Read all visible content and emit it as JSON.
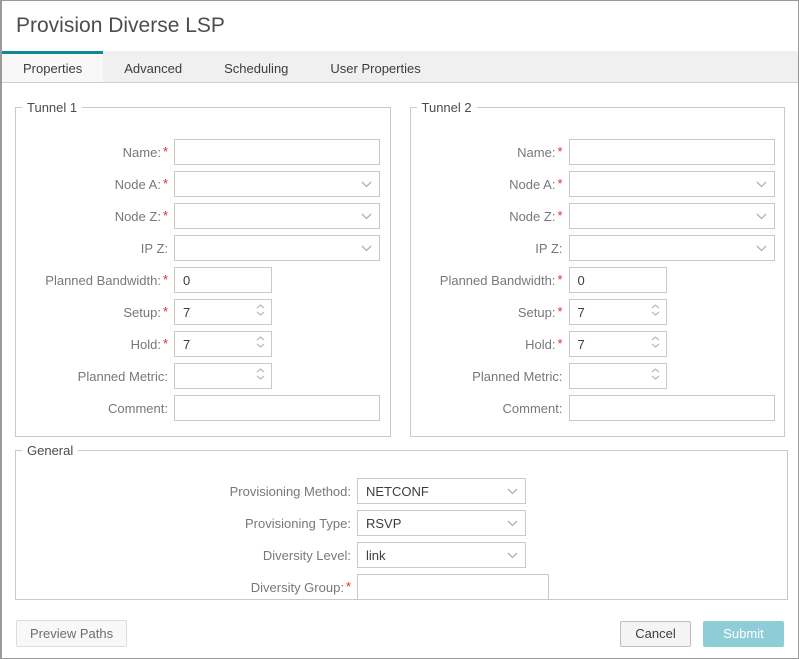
{
  "header": {
    "title": "Provision Diverse LSP"
  },
  "tabs": [
    {
      "label": "Properties",
      "active": true
    },
    {
      "label": "Advanced",
      "active": false
    },
    {
      "label": "Scheduling",
      "active": false
    },
    {
      "label": "User Properties",
      "active": false
    }
  ],
  "ui": {
    "required_marker": "*"
  },
  "colors": {
    "accent_teal": "#0e8a96",
    "submit_bg": "#8ecdd8",
    "required_red": "#e32b24"
  },
  "tunnel1": {
    "legend": "Tunnel 1",
    "fields": [
      {
        "label": "Name:",
        "required": true,
        "type": "text",
        "value": ""
      },
      {
        "label": "Node A:",
        "required": true,
        "type": "select",
        "value": ""
      },
      {
        "label": "Node Z:",
        "required": true,
        "type": "select",
        "value": ""
      },
      {
        "label": "IP Z:",
        "required": false,
        "type": "select",
        "value": ""
      },
      {
        "label": "Planned Bandwidth:",
        "required": true,
        "type": "text",
        "value": "0"
      },
      {
        "label": "Setup:",
        "required": true,
        "type": "spinner",
        "value": "7"
      },
      {
        "label": "Hold:",
        "required": true,
        "type": "spinner",
        "value": "7"
      },
      {
        "label": "Planned Metric:",
        "required": false,
        "type": "spinner",
        "value": ""
      },
      {
        "label": "Comment:",
        "required": false,
        "type": "text",
        "value": ""
      }
    ]
  },
  "tunnel2": {
    "legend": "Tunnel 2",
    "fields": [
      {
        "label": "Name:",
        "required": true,
        "type": "text",
        "value": ""
      },
      {
        "label": "Node A:",
        "required": true,
        "type": "select",
        "value": ""
      },
      {
        "label": "Node Z:",
        "required": true,
        "type": "select",
        "value": ""
      },
      {
        "label": "IP Z:",
        "required": false,
        "type": "select",
        "value": ""
      },
      {
        "label": "Planned Bandwidth:",
        "required": true,
        "type": "text",
        "value": "0"
      },
      {
        "label": "Setup:",
        "required": true,
        "type": "spinner",
        "value": "7"
      },
      {
        "label": "Hold:",
        "required": true,
        "type": "spinner",
        "value": "7"
      },
      {
        "label": "Planned Metric:",
        "required": false,
        "type": "spinner",
        "value": ""
      },
      {
        "label": "Comment:",
        "required": false,
        "type": "text",
        "value": ""
      }
    ]
  },
  "general": {
    "legend": "General",
    "fields": [
      {
        "label": "Provisioning Method:",
        "required": false,
        "type": "select",
        "value": "NETCONF"
      },
      {
        "label": "Provisioning Type:",
        "required": false,
        "type": "select",
        "value": "RSVP"
      },
      {
        "label": "Diversity Level:",
        "required": false,
        "type": "select",
        "value": "link"
      },
      {
        "label": "Diversity Group:",
        "required": true,
        "type": "text",
        "value": ""
      }
    ]
  },
  "footer": {
    "preview_paths_label": "Preview Paths",
    "cancel_label": "Cancel",
    "submit_label": "Submit"
  }
}
